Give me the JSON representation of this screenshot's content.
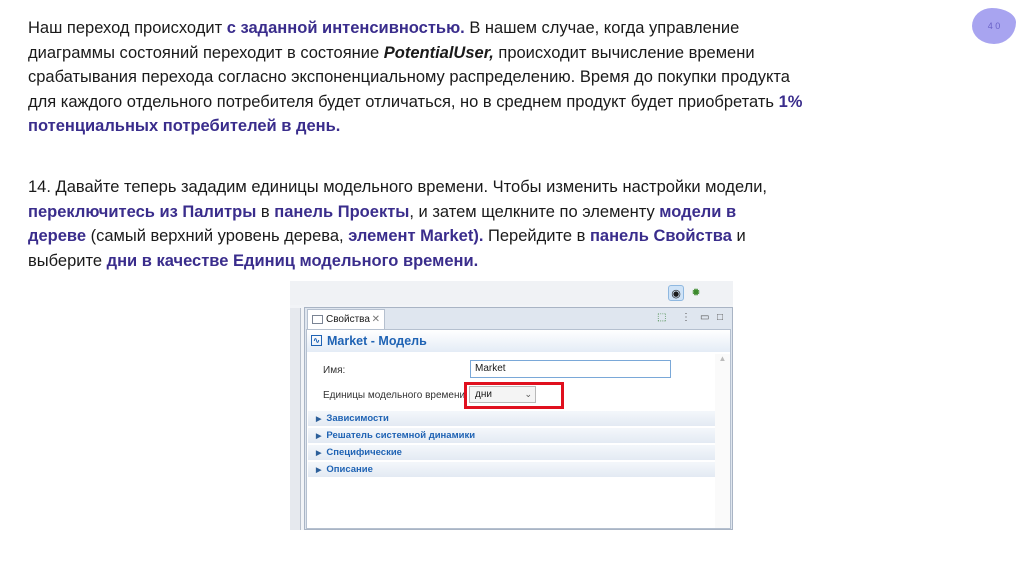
{
  "slide_number": "4 0",
  "p1": [
    "Наш переход происходит ",
    "с заданной интенсивностью.",
    " В нашем случае, когда управление диаграммы состояний переходит в состояние ",
    "PotentialUser,",
    " происходит вычисление времени срабатывания перехода согласно экспоненциальному распределению. Время до покупки продукта для каждого отдельного потребителя будет отличаться, но в среднем продукт будет приобретать ",
    "1% потенциальных потребителей в день."
  ],
  "p2": [
    "14. Давайте теперь зададим единицы модельного времени. Чтобы изменить настройки модели, ",
    "переключитесь из Палитры",
    " в ",
    "панель Проекты",
    ", и затем щелкните по элементу ",
    "модели в дереве",
    " (самый верхний уровень дерева, ",
    "элемент Market).",
    " Перейдите в ",
    "панель Свойства",
    " и выберите ",
    "дни в качестве Единиц модельного времени."
  ],
  "screenshot": {
    "tab_label": "Свойства",
    "title": "Market - Модель",
    "name_label": "Имя:",
    "name_value": "Market",
    "units_label": "Единицы модельного времени:",
    "units_value": "дни",
    "sections": [
      "Зависимости",
      "Решатель системной динамики",
      "Специфические",
      "Описание"
    ]
  },
  "colors": {
    "accent": "#3a2d8c",
    "highlight": "#e0101e",
    "panel_blue": "#1f63b4"
  }
}
